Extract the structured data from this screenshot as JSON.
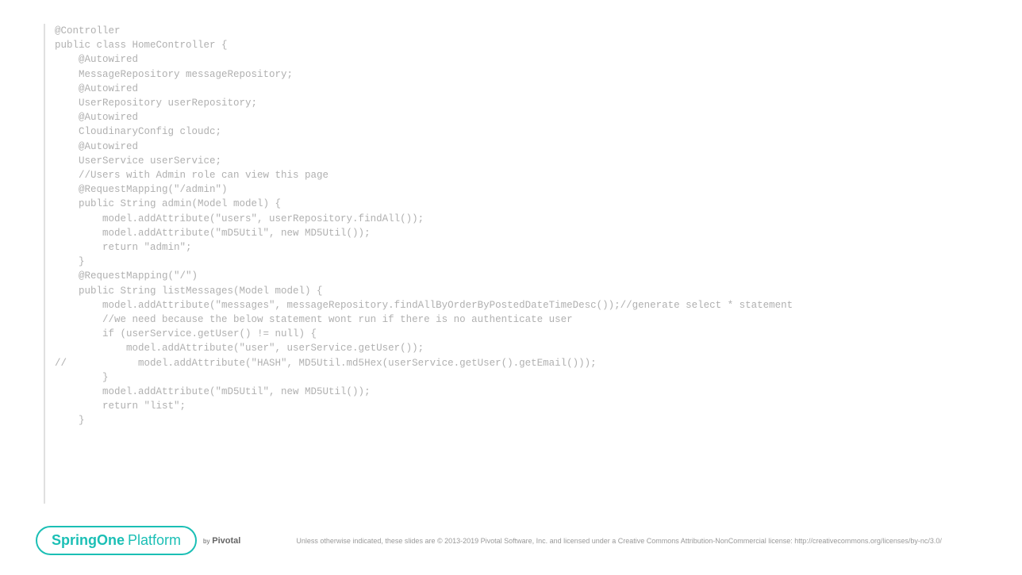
{
  "code": {
    "lines": [
      "",
      "@Controller",
      "public class HomeController {",
      "    @Autowired",
      "    MessageRepository messageRepository;",
      "",
      "    @Autowired",
      "    UserRepository userRepository;",
      "",
      "    @Autowired",
      "    CloudinaryConfig cloudc;",
      "",
      "    @Autowired",
      "    UserService userService;",
      "",
      "    //Users with Admin role can view this page",
      "    @RequestMapping(\"/admin\")",
      "    public String admin(Model model) {",
      "        model.addAttribute(\"users\", userRepository.findAll());",
      "        model.addAttribute(\"mD5Util\", new MD5Util());",
      "        return \"admin\";",
      "    }",
      "",
      "    @RequestMapping(\"/\")",
      "    public String listMessages(Model model) {",
      "        model.addAttribute(\"messages\", messageRepository.findAllByOrderByPostedDateTimeDesc());//generate select * statement",
      "        //we need because the below statement wont run if there is no authenticate user",
      "        if (userService.getUser() != null) {",
      "            model.addAttribute(\"user\", userService.getUser());",
      "//            model.addAttribute(\"HASH\", MD5Util.md5Hex(userService.getUser().getEmail()));",
      "        }",
      "        model.addAttribute(\"mD5Util\", new MD5Util());",
      "        return \"list\";",
      "    }"
    ]
  },
  "footer": {
    "logo_spring": "SpringOne",
    "logo_platform": "Platform",
    "by": "by",
    "pivotal": "Pivotal",
    "copyright": "Unless otherwise indicated, these slides are © 2013-2019 Pivotal Software, Inc. and licensed under a Creative Commons Attribution-NonCommercial license: http://creativecommons.org/licenses/by-nc/3.0/"
  }
}
